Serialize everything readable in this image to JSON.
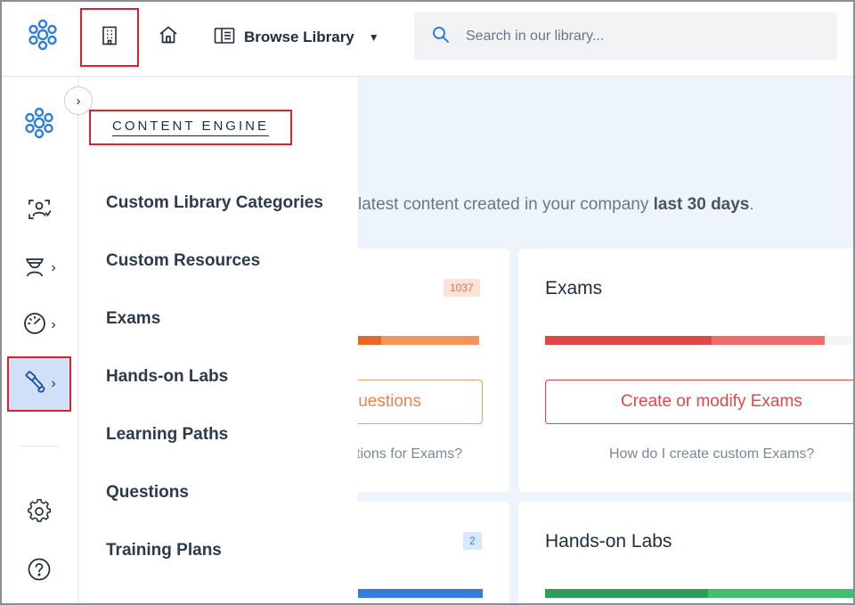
{
  "topbar": {
    "browse_label": "Browse Library",
    "search_placeholder": "Search in our library..."
  },
  "panel": {
    "title": "CONTENT ENGINE",
    "items": [
      "Custom Library Categories",
      "Custom Resources",
      "Exams",
      "Hands-on Labs",
      "Learning Paths",
      "Questions",
      "Training Plans"
    ]
  },
  "main": {
    "intro_text": "latest content created in your company ",
    "intro_bold": "last 30 days",
    "intro_end": ".",
    "questions_card": {
      "count": "1037",
      "button_label": "uestions",
      "help_text": "tions for Exams?"
    },
    "exams_card": {
      "title": "Exams",
      "button_label": "Create or modify Exams",
      "help_text": "How do I create custom Exams?"
    },
    "second_left_card": {
      "count": "2"
    },
    "labs_card": {
      "title": "Hands-on Labs"
    }
  },
  "colors": {
    "highlight_border": "#d7232f",
    "accent_blue": "#2f7de1",
    "exams_red": "#e04848",
    "questions_orange": "#f0955e",
    "labs_green": "#2e9e5b"
  }
}
